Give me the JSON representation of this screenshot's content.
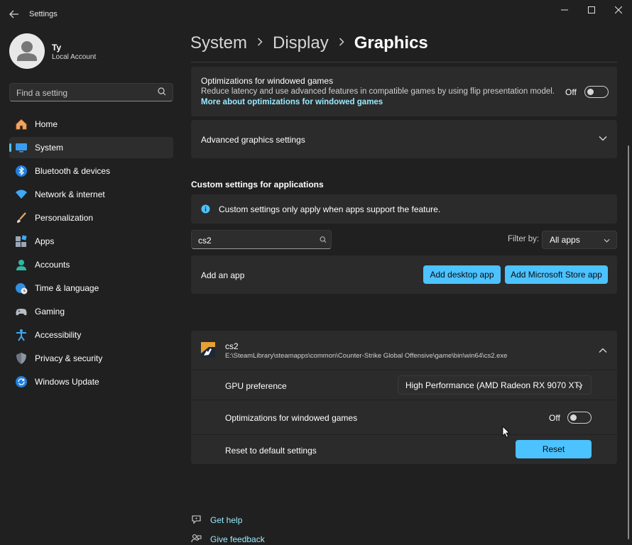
{
  "window": {
    "title": "Settings"
  },
  "user": {
    "name": "Ty",
    "account_type": "Local Account"
  },
  "search": {
    "placeholder": "Find a setting"
  },
  "nav": [
    {
      "label": "Home",
      "icon": "home-icon"
    },
    {
      "label": "System",
      "icon": "system-icon",
      "active": true
    },
    {
      "label": "Bluetooth & devices",
      "icon": "bluetooth-icon"
    },
    {
      "label": "Network & internet",
      "icon": "wifi-icon"
    },
    {
      "label": "Personalization",
      "icon": "brush-icon"
    },
    {
      "label": "Apps",
      "icon": "apps-icon"
    },
    {
      "label": "Accounts",
      "icon": "accounts-icon"
    },
    {
      "label": "Time & language",
      "icon": "globe-clock-icon"
    },
    {
      "label": "Gaming",
      "icon": "gamepad-icon"
    },
    {
      "label": "Accessibility",
      "icon": "accessibility-icon"
    },
    {
      "label": "Privacy & security",
      "icon": "shield-icon"
    },
    {
      "label": "Windows Update",
      "icon": "update-icon"
    }
  ],
  "breadcrumb": {
    "level1": "System",
    "level2": "Display",
    "current": "Graphics"
  },
  "windowed_games": {
    "title": "Optimizations for windowed games",
    "description": "Reduce latency and use advanced features in compatible games by using flip presentation model.",
    "link": "More about optimizations for windowed games",
    "state": "Off"
  },
  "advanced": {
    "title": "Advanced graphics settings"
  },
  "custom": {
    "heading": "Custom settings for applications",
    "info": "Custom settings only apply when apps support the feature.",
    "search_value": "cs2",
    "filter_label": "Filter by:",
    "filter_value": "All apps",
    "add_app_label": "Add an app",
    "add_desktop": "Add desktop app",
    "add_store": "Add Microsoft Store app"
  },
  "app": {
    "name": "cs2",
    "path": "E:\\SteamLibrary\\steamapps\\common\\Counter-Strike Global Offensive\\game\\bin\\win64\\cs2.exe",
    "gpu_label": "GPU preference",
    "gpu_value": "High Performance (AMD Radeon RX 9070 XT)",
    "opt_label": "Optimizations for windowed games",
    "opt_state": "Off",
    "reset_label": "Reset to default settings",
    "reset_button": "Reset"
  },
  "footer": {
    "help": "Get help",
    "feedback": "Give feedback"
  },
  "colors": {
    "accent": "#4cc2ff",
    "link": "#99ebff",
    "background": "#202020",
    "card": "#2b2b2b"
  }
}
